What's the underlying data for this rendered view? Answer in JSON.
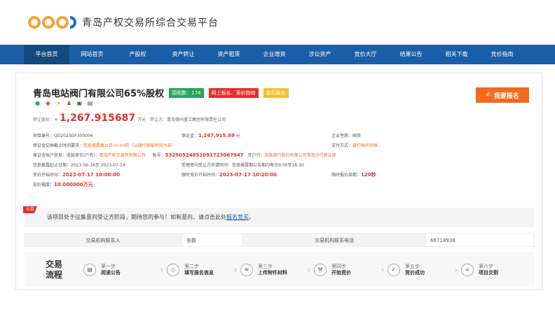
{
  "site": {
    "name": "青岛产权交易所综合交易平台"
  },
  "nav": {
    "items": [
      "平台首页",
      "网站首页",
      "产股权",
      "资产转让",
      "资产租赁",
      "企业增资",
      "涉讼资产",
      "竞价大厅",
      "结果公告",
      "相关下载",
      "竞价指南"
    ]
  },
  "project": {
    "title": "青岛电站阀门有限公司65%股权",
    "tag_views": "围观数：174",
    "tag_signup": "网上报名、竞价指南",
    "tag_service": "会员服务",
    "signup_button": "我要报名",
    "price_label": "转让底价：￥",
    "price_value": "1,267.915687",
    "price_unit": "万元",
    "transferor_label": "转让方：",
    "transferor": "青岛德州重工集团有限责任公司"
  },
  "info": {
    "project_no_label": "项目编号：",
    "project_no": "QD2023DF300006",
    "deposit_label": "保证金：",
    "deposit_value": "1,267,915.69",
    "deposit_unit": "元",
    "enterprise_label": "企业性质：",
    "enterprise": "国资",
    "deadline_label": "保证金交纳截止时间要求：",
    "deadline_value": "信息披露截止日16:00前",
    "deadline_note": "（以银行到账时间为准）",
    "pay_label": "支付方式：",
    "pay_value": "银行帐号转账",
    "account_label": "保证金账户信息：",
    "account_owner_label": "收款单位(户名)：",
    "account_owner": "青岛产权交易所有限公司",
    "account_no_label": "账号：",
    "account_no": "532905248510917230679​47",
    "bank_label": "开户行：",
    "bank": "招商银行股份有限公司青岛分行营业部",
    "period_label": "信息披露起止日期：",
    "period": "2023-06-16至 2023-07-14",
    "accept_note": "受理意向受让方申请时间：信息披露期公告期内每日9:00至16:30",
    "start_label": "竞价开始时间：",
    "start_value": "2023-07-17 10:00:00",
    "end_label": "限时竞价开始时间：",
    "end_value": "2023-07-17 10:20:00",
    "limit_label": "限时报价周期：",
    "limit_value": "120秒",
    "increment_label": "加价幅度：",
    "increment_value": "10.000000",
    "increment_unit": "万元"
  },
  "notice": {
    "tag": "公告",
    "text": "该项目处于征集意向受让方阶段，期待您的参与！如有意向，请点击此处",
    "link": "报名竞买",
    "tail": "。"
  },
  "contact": {
    "person_label": "交易机构联系人",
    "person": "张磊",
    "phone_label": "交易机构联系电话",
    "phone": "66718938"
  },
  "process": {
    "title_line1": "交易",
    "title_line2": "流程",
    "steps": [
      {
        "n": "第一步",
        "t": "阅读公告",
        "icon": "document-icon"
      },
      {
        "n": "第二步",
        "t": "填写报名信息",
        "icon": "tag-icon"
      },
      {
        "n": "第三步",
        "t": "上传附件材料",
        "icon": "coins-icon"
      },
      {
        "n": "第四步",
        "t": "开始竞价",
        "icon": "gavel-icon"
      },
      {
        "n": "第五步",
        "t": "竞价成功",
        "icon": "check-icon"
      },
      {
        "n": "第六步",
        "t": "项目交割",
        "icon": "handshake-icon"
      }
    ]
  }
}
